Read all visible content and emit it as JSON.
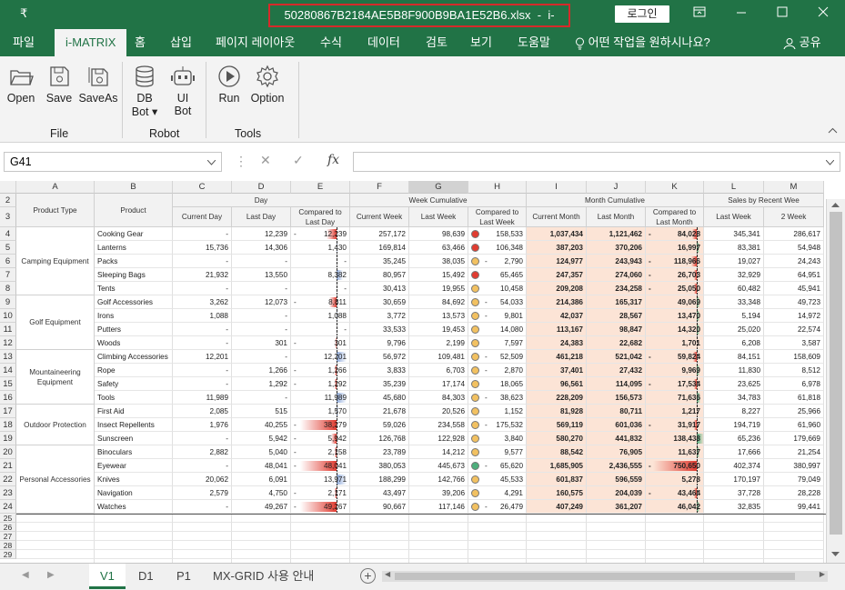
{
  "title": {
    "file": "50280867B2184AE5B8F900B9BA1E52B6.xlsx",
    "sep": "-",
    "app": "i-MATRIX",
    "login": "로그인",
    "qat": "₹"
  },
  "menu": [
    "파일",
    "i-MATRIX",
    "홈",
    "삽입",
    "페이지 레이아웃",
    "수식",
    "데이터",
    "검토",
    "보기",
    "도움말"
  ],
  "tell_me": "어떤 작업을 원하시나요?",
  "share": "공유",
  "ribbon": {
    "file_group": "File",
    "robot_group": "Robot",
    "tools_group": "Tools",
    "open": "Open",
    "save": "Save",
    "saveas": "SaveAs",
    "db": "DB",
    "bot": "Bot ▾",
    "ui": "UI",
    "uibot": "Bot",
    "run": "Run",
    "option": "Option"
  },
  "namebox": "G41",
  "fx": "fx",
  "columns": [
    "A",
    "B",
    "C",
    "D",
    "E",
    "F",
    "G",
    "H",
    "I",
    "J",
    "K",
    "L",
    "M"
  ],
  "header": {
    "product_type": "Product Type",
    "product": "Product",
    "day": "Day",
    "week": "Week Cumulative",
    "month": "Month Cumulative",
    "recent": "Sales by Recent Wee",
    "c": "Current Day",
    "d": "Last Day",
    "e": "Compared to Last Day",
    "f": "Current Week",
    "g": "Last Week",
    "h": "Compared to Last Week",
    "i": "Current Month",
    "j": "Last Month",
    "k": "Compared to Last Month",
    "l": "Last Week",
    "m": "2 Week"
  },
  "groups": [
    {
      "name": "Camping Equipment",
      "start": 0,
      "len": 5
    },
    {
      "name": "Golf Equipment",
      "start": 5,
      "len": 4
    },
    {
      "name": "Mountaineering Equipment",
      "start": 9,
      "len": 4
    },
    {
      "name": "Outdoor Protection",
      "start": 13,
      "len": 3
    },
    {
      "name": "Personal Accessories",
      "start": 16,
      "len": 5
    }
  ],
  "rows": [
    [
      "Cooking Gear",
      "-",
      "12,239",
      "-",
      "12,239",
      "257,172",
      "98,639",
      "red",
      "158,533",
      "1,037,434",
      "1,121,462",
      "-",
      "84,028",
      "345,341",
      "286,617"
    ],
    [
      "Lanterns",
      "15,736",
      "14,306",
      "",
      "1,430",
      "169,814",
      "63,466",
      "red",
      "106,348",
      "387,203",
      "370,206",
      "",
      "16,997",
      "83,381",
      "54,948"
    ],
    [
      "Packs",
      "-",
      "-",
      "",
      "-",
      "35,245",
      "38,035",
      "yellow",
      "2,790",
      "124,977",
      "243,943",
      "-",
      "118,966",
      "19,027",
      "24,243"
    ],
    [
      "Sleeping Bags",
      "21,932",
      "13,550",
      "",
      "8,382",
      "80,957",
      "15,492",
      "red",
      "65,465",
      "247,357",
      "274,060",
      "-",
      "26,703",
      "32,929",
      "64,951"
    ],
    [
      "Tents",
      "-",
      "-",
      "",
      "-",
      "30,413",
      "19,955",
      "yellow",
      "10,458",
      "209,208",
      "234,258",
      "-",
      "25,050",
      "60,482",
      "45,941"
    ],
    [
      "Golf Accessories",
      "3,262",
      "12,073",
      "-",
      "8,811",
      "30,659",
      "84,692",
      "yellow",
      "54,033",
      "214,386",
      "165,317",
      "",
      "49,069",
      "33,348",
      "49,723"
    ],
    [
      "Irons",
      "1,088",
      "-",
      "",
      "1,088",
      "3,772",
      "13,573",
      "yellow",
      "9,801",
      "42,037",
      "28,567",
      "",
      "13,470",
      "5,194",
      "14,972"
    ],
    [
      "Putters",
      "-",
      "-",
      "",
      "-",
      "33,533",
      "19,453",
      "yellow",
      "14,080",
      "113,167",
      "98,847",
      "",
      "14,320",
      "25,020",
      "22,574"
    ],
    [
      "Woods",
      "-",
      "301",
      "-",
      "301",
      "9,796",
      "2,199",
      "yellow",
      "7,597",
      "24,383",
      "22,682",
      "",
      "1,701",
      "6,208",
      "3,587"
    ],
    [
      "Climbing Accessories",
      "12,201",
      "-",
      "",
      "12,201",
      "56,972",
      "109,481",
      "yellow",
      "52,509",
      "461,218",
      "521,042",
      "-",
      "59,824",
      "84,151",
      "158,609"
    ],
    [
      "Rope",
      "-",
      "1,266",
      "-",
      "1,266",
      "3,833",
      "6,703",
      "yellow",
      "2,870",
      "37,401",
      "27,432",
      "",
      "9,969",
      "11,830",
      "8,512"
    ],
    [
      "Safety",
      "-",
      "1,292",
      "-",
      "1,292",
      "35,239",
      "17,174",
      "yellow",
      "18,065",
      "96,561",
      "114,095",
      "-",
      "17,534",
      "23,625",
      "6,978"
    ],
    [
      "Tools",
      "11,989",
      "-",
      "",
      "11,989",
      "45,680",
      "84,303",
      "yellow",
      "38,623",
      "228,209",
      "156,573",
      "",
      "71,636",
      "34,783",
      "61,818"
    ],
    [
      "First Aid",
      "2,085",
      "515",
      "",
      "1,570",
      "21,678",
      "20,526",
      "yellow",
      "1,152",
      "81,928",
      "80,711",
      "",
      "1,217",
      "8,227",
      "25,966"
    ],
    [
      "Insect Repellents",
      "1,976",
      "40,255",
      "-",
      "38,279",
      "59,026",
      "234,558",
      "yellow",
      "175,532",
      "569,119",
      "601,036",
      "-",
      "31,917",
      "194,719",
      "61,960"
    ],
    [
      "Sunscreen",
      "-",
      "5,942",
      "-",
      "5,942",
      "126,768",
      "122,928",
      "yellow",
      "3,840",
      "580,270",
      "441,832",
      "",
      "138,438",
      "65,236",
      "179,669"
    ],
    [
      "Binoculars",
      "2,882",
      "5,040",
      "-",
      "2,158",
      "23,789",
      "14,212",
      "yellow",
      "9,577",
      "88,542",
      "76,905",
      "",
      "11,637",
      "17,666",
      "21,254"
    ],
    [
      "Eyewear",
      "-",
      "48,041",
      "-",
      "48,041",
      "380,053",
      "445,673",
      "green",
      "65,620",
      "1,685,905",
      "2,436,555",
      "-",
      "750,650",
      "402,374",
      "380,997"
    ],
    [
      "Knives",
      "20,062",
      "6,091",
      "",
      "13,971",
      "188,299",
      "142,766",
      "yellow",
      "45,533",
      "601,837",
      "596,559",
      "",
      "5,278",
      "170,197",
      "79,049"
    ],
    [
      "Navigation",
      "2,579",
      "4,750",
      "-",
      "2,171",
      "43,497",
      "39,206",
      "yellow",
      "4,291",
      "160,575",
      "204,039",
      "-",
      "43,464",
      "37,728",
      "28,228"
    ],
    [
      "Watches",
      "-",
      "49,267",
      "-",
      "49,267",
      "90,667",
      "117,146",
      "yellow",
      "26,479",
      "407,249",
      "361,207",
      "",
      "46,042",
      "32,835",
      "99,441"
    ]
  ],
  "neg_flags": {
    "h": [
      false,
      false,
      true,
      false,
      false,
      true,
      true,
      false,
      false,
      true,
      true,
      false,
      true,
      false,
      true,
      false,
      false,
      true,
      false,
      false,
      true
    ]
  },
  "bars": {
    "e": [
      [
        -0.18,
        "red"
      ],
      [
        0.02,
        "blue"
      ],
      [
        0,
        ""
      ],
      [
        0.12,
        "blue"
      ],
      [
        0,
        ""
      ],
      [
        -0.14,
        "red"
      ],
      [
        0.02,
        "blue"
      ],
      [
        0,
        ""
      ],
      [
        -0.01,
        "red"
      ],
      [
        0.18,
        "blue"
      ],
      [
        -0.03,
        "red"
      ],
      [
        -0.03,
        "red"
      ],
      [
        0.18,
        "blue"
      ],
      [
        0.03,
        "blue"
      ],
      [
        -0.66,
        "red"
      ],
      [
        -0.1,
        "red"
      ],
      [
        -0.04,
        "red"
      ],
      [
        -0.66,
        "red"
      ],
      [
        0.18,
        "blue"
      ],
      [
        -0.04,
        "red"
      ],
      [
        -0.66,
        "red"
      ]
    ],
    "k": [
      [
        -0.05,
        "red"
      ],
      [
        0.01,
        "green"
      ],
      [
        -0.06,
        "red"
      ],
      [
        -0.02,
        "red"
      ],
      [
        -0.02,
        "red"
      ],
      [
        0.03,
        "green"
      ],
      [
        0.01,
        "green"
      ],
      [
        0.01,
        "green"
      ],
      [
        0,
        "green"
      ],
      [
        -0.04,
        "red"
      ],
      [
        0.01,
        "green"
      ],
      [
        -0.01,
        "red"
      ],
      [
        0.04,
        "green"
      ],
      [
        0,
        "green"
      ],
      [
        -0.02,
        "red"
      ],
      [
        0.08,
        "green"
      ],
      [
        0.01,
        "green"
      ],
      [
        -0.48,
        "red"
      ],
      [
        0,
        "green"
      ],
      [
        -0.03,
        "red"
      ],
      [
        0.03,
        "green"
      ]
    ]
  },
  "sheets": [
    "V1",
    "D1",
    "P1",
    "MX-GRID 사용 안내"
  ],
  "colors": {
    "accent": "#217346",
    "red": "#e03c31",
    "yellow": "#f2c161",
    "green": "#4daf7c",
    "blue": "#8eaadb",
    "peach": "#fce4d6"
  }
}
